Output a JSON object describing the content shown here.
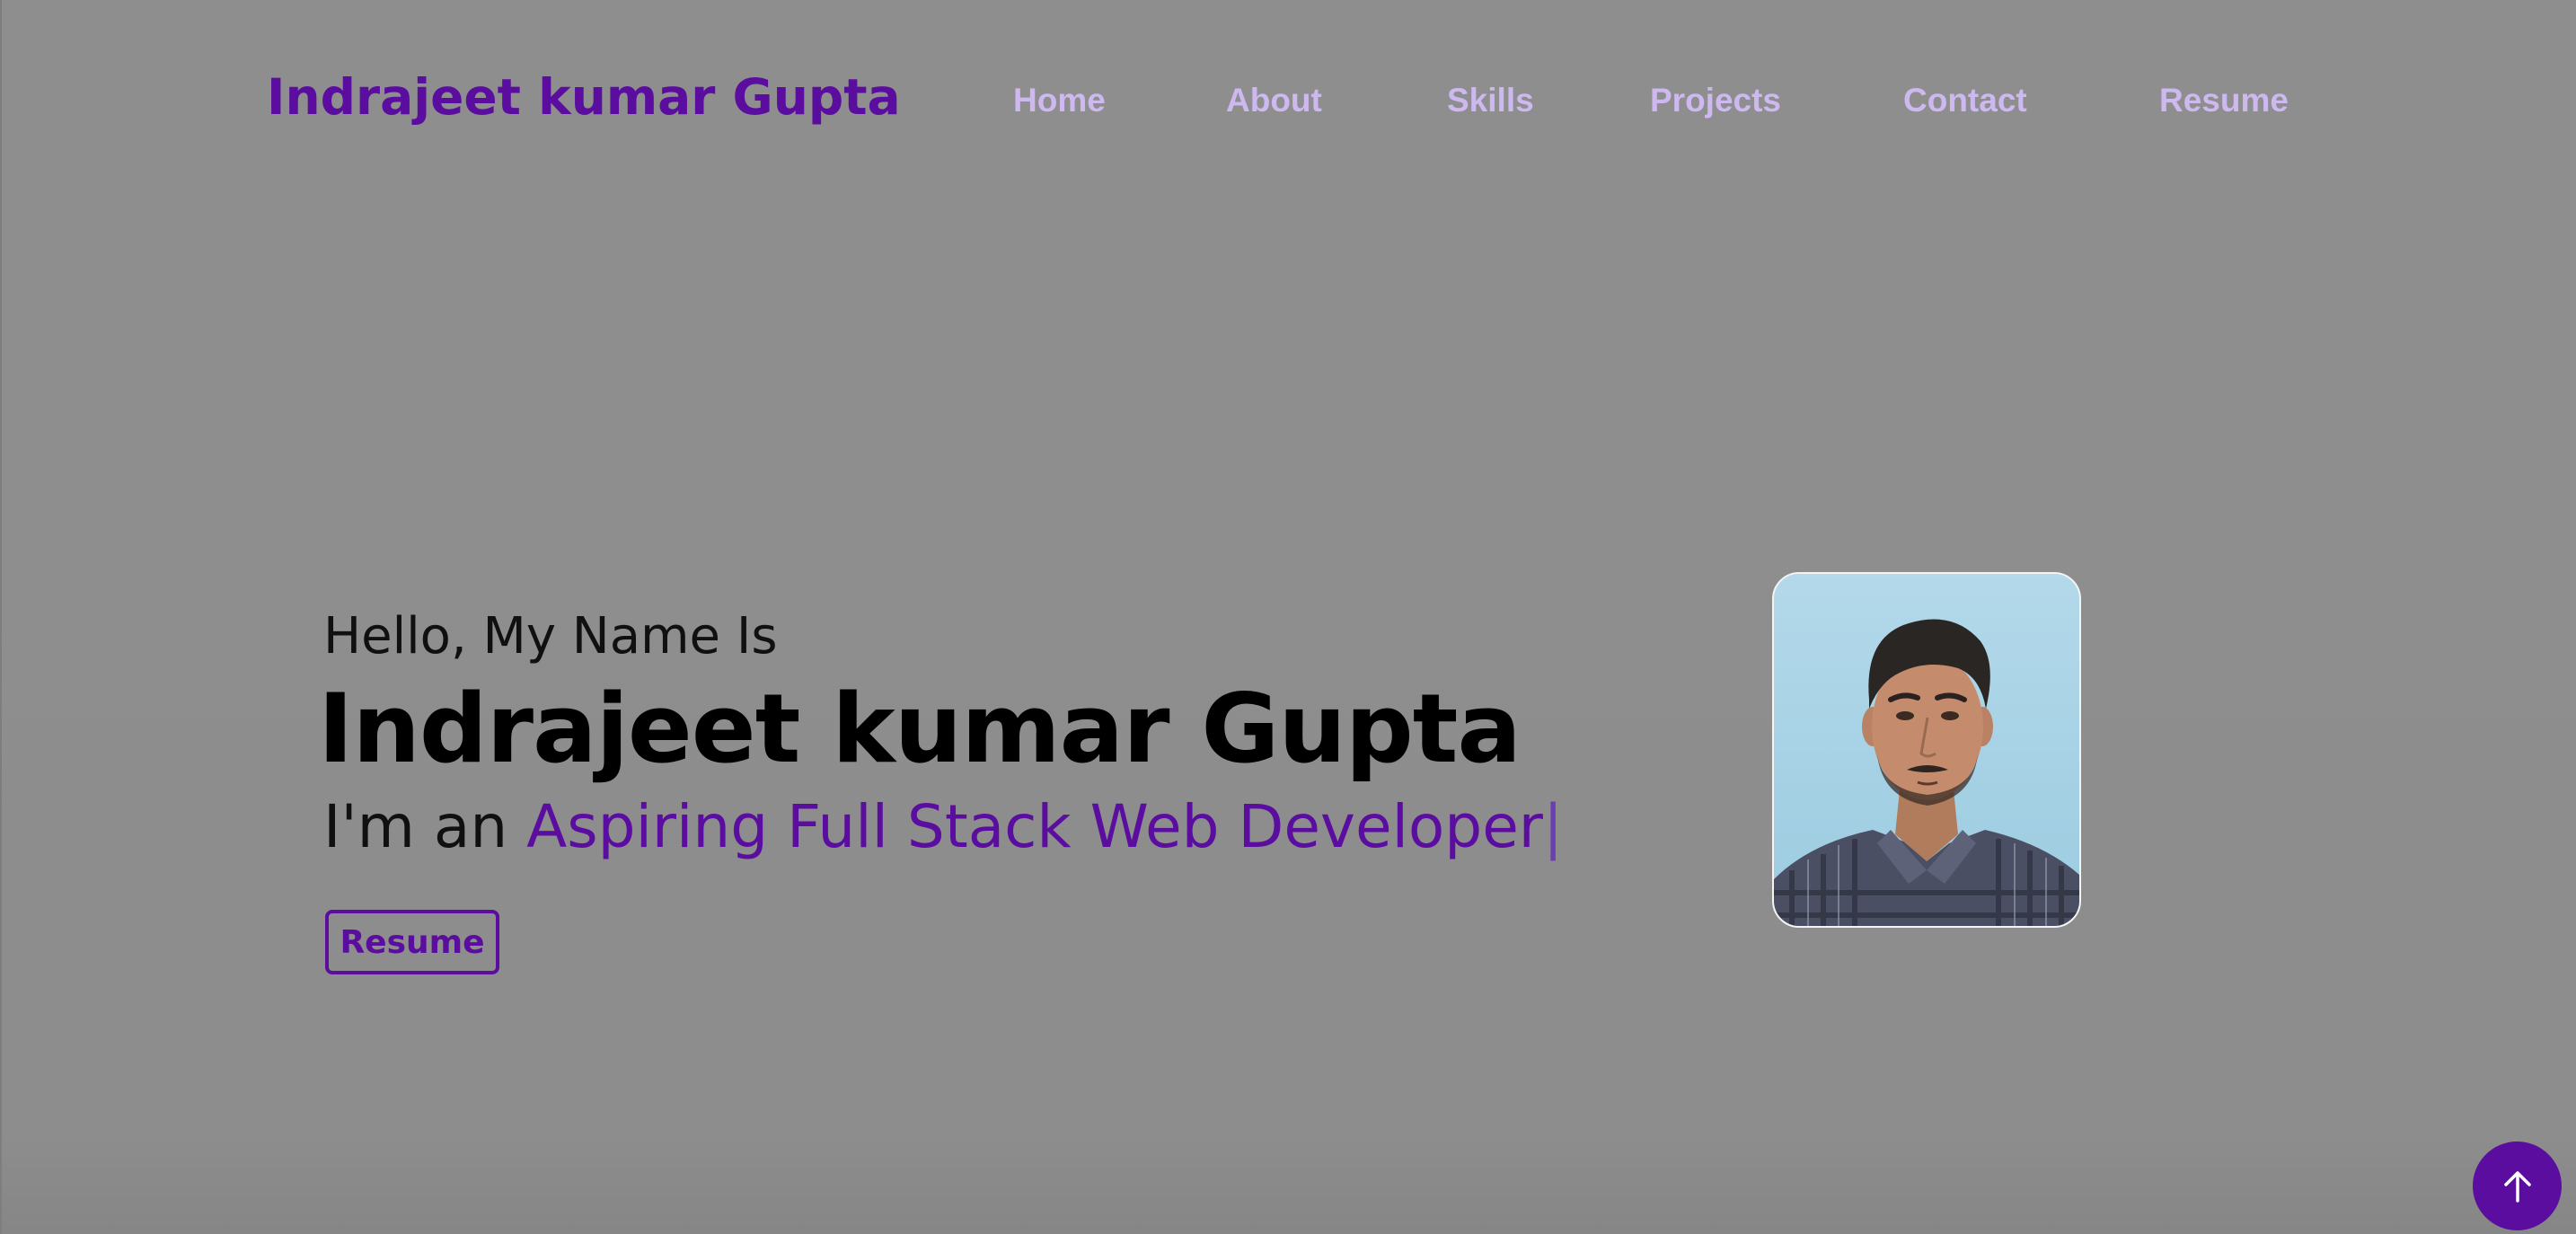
{
  "header": {
    "brand": "Indrajeet kumar Gupta",
    "nav": [
      {
        "label": "Home"
      },
      {
        "label": "About"
      },
      {
        "label": "Skills"
      },
      {
        "label": "Projects"
      },
      {
        "label": "Contact"
      },
      {
        "label": "Resume"
      }
    ]
  },
  "hero": {
    "greeting": "Hello, My Name Is",
    "name": "Indrajeet kumar Gupta",
    "tagline_prefix": "I'm an ",
    "tagline_role": "Aspiring Full Stack Web Developer",
    "typing_cursor": "|",
    "resume_button": "Resume"
  },
  "icons": {
    "scroll_top": "arrow-up-icon"
  },
  "colors": {
    "background": "#8e8e8e",
    "accent": "#5a0d9e",
    "nav_text": "#cdb8f0",
    "heading": "#000000"
  }
}
